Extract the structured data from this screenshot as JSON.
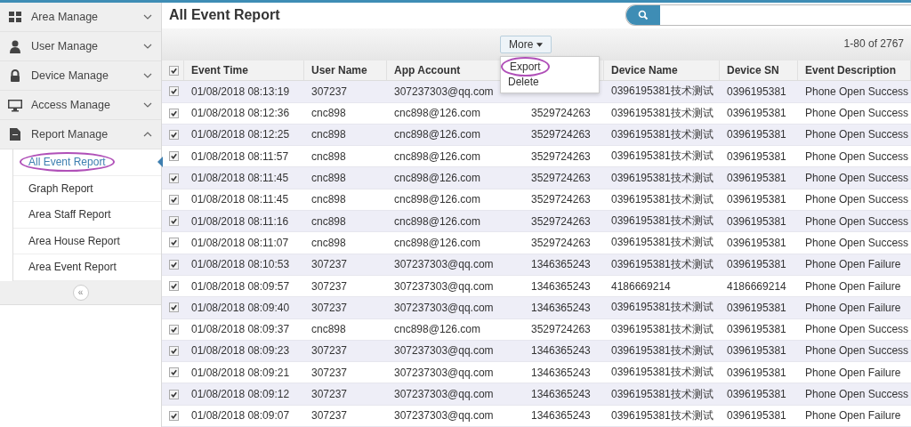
{
  "sidebar": {
    "items": [
      {
        "label": "Area Manage",
        "expanded": false
      },
      {
        "label": "User Manage",
        "expanded": false
      },
      {
        "label": "Device Manage",
        "expanded": false
      },
      {
        "label": "Access Manage",
        "expanded": false
      },
      {
        "label": "Report Manage",
        "expanded": true,
        "children": [
          {
            "label": "All Event Report",
            "selected": true,
            "circled": true
          },
          {
            "label": "Graph Report",
            "selected": false,
            "circled": false
          },
          {
            "label": "Area Staff Report",
            "selected": false,
            "circled": false
          },
          {
            "label": "Area House Report",
            "selected": false,
            "circled": false
          },
          {
            "label": "Area Event Report",
            "selected": false,
            "circled": false
          }
        ]
      }
    ],
    "collapse_button": "«"
  },
  "page": {
    "title": "All Event Report"
  },
  "toolbar": {
    "more_button": "More",
    "menu": {
      "open": true,
      "items": [
        {
          "label": "Export",
          "circled": true
        },
        {
          "label": "Delete",
          "circled": false
        }
      ]
    },
    "pager": "1-80 of 2767"
  },
  "table": {
    "select_all": {
      "checked": true
    },
    "columns": [
      {
        "label": "Event Time"
      },
      {
        "label": "User Name"
      },
      {
        "label": "App Account"
      },
      {},
      {
        "label": "Device Name"
      },
      {
        "label": "Device SN"
      },
      {
        "label": "Event Description"
      }
    ],
    "rows": [
      {
        "checked": true,
        "cells": [
          "01/08/2018 08:13:19",
          "307237",
          "307237303@qq.com",
          null,
          "0396195381技术测试",
          "0396195381",
          "Phone Open Success"
        ]
      },
      {
        "checked": true,
        "cells": [
          "01/08/2018 08:12:36",
          "cnc898",
          "cnc898@126.com",
          "3529724263",
          "0396195381技术测试",
          "0396195381",
          "Phone Open Success"
        ]
      },
      {
        "checked": true,
        "cells": [
          "01/08/2018 08:12:25",
          "cnc898",
          "cnc898@126.com",
          "3529724263",
          "0396195381技术测试",
          "0396195381",
          "Phone Open Success"
        ]
      },
      {
        "checked": true,
        "cells": [
          "01/08/2018 08:11:57",
          "cnc898",
          "cnc898@126.com",
          "3529724263",
          "0396195381技术测试",
          "0396195381",
          "Phone Open Success"
        ]
      },
      {
        "checked": true,
        "cells": [
          "01/08/2018 08:11:45",
          "cnc898",
          "cnc898@126.com",
          "3529724263",
          "0396195381技术测试",
          "0396195381",
          "Phone Open Success"
        ]
      },
      {
        "checked": true,
        "cells": [
          "01/08/2018 08:11:45",
          "cnc898",
          "cnc898@126.com",
          "3529724263",
          "0396195381技术测试",
          "0396195381",
          "Phone Open Success"
        ]
      },
      {
        "checked": true,
        "cells": [
          "01/08/2018 08:11:16",
          "cnc898",
          "cnc898@126.com",
          "3529724263",
          "0396195381技术测试",
          "0396195381",
          "Phone Open Success"
        ]
      },
      {
        "checked": true,
        "cells": [
          "01/08/2018 08:11:07",
          "cnc898",
          "cnc898@126.com",
          "3529724263",
          "0396195381技术测试",
          "0396195381",
          "Phone Open Success"
        ]
      },
      {
        "checked": true,
        "cells": [
          "01/08/2018 08:10:53",
          "307237",
          "307237303@qq.com",
          "1346365243",
          "0396195381技术测试",
          "0396195381",
          "Phone Open Failure"
        ]
      },
      {
        "checked": true,
        "cells": [
          "01/08/2018 08:09:57",
          "307237",
          "307237303@qq.com",
          "1346365243",
          "4186669214",
          "4186669214",
          "Phone Open Failure"
        ]
      },
      {
        "checked": true,
        "cells": [
          "01/08/2018 08:09:40",
          "307237",
          "307237303@qq.com",
          "1346365243",
          "0396195381技术测试",
          "0396195381",
          "Phone Open Failure"
        ]
      },
      {
        "checked": true,
        "cells": [
          "01/08/2018 08:09:37",
          "cnc898",
          "cnc898@126.com",
          "3529724263",
          "0396195381技术测试",
          "0396195381",
          "Phone Open Success"
        ]
      },
      {
        "checked": true,
        "cells": [
          "01/08/2018 08:09:23",
          "307237",
          "307237303@qq.com",
          "1346365243",
          "0396195381技术测试",
          "0396195381",
          "Phone Open Success"
        ]
      },
      {
        "checked": true,
        "cells": [
          "01/08/2018 08:09:21",
          "307237",
          "307237303@qq.com",
          "1346365243",
          "0396195381技术测试",
          "0396195381",
          "Phone Open Failure"
        ]
      },
      {
        "checked": true,
        "cells": [
          "01/08/2018 08:09:12",
          "307237",
          "307237303@qq.com",
          "1346365243",
          "0396195381技术测试",
          "0396195381",
          "Phone Open Success"
        ]
      },
      {
        "checked": true,
        "cells": [
          "01/08/2018 08:09:07",
          "307237",
          "307237303@qq.com",
          "1346365243",
          "0396195381技术测试",
          "0396195381",
          "Phone Open Failure"
        ]
      }
    ]
  }
}
